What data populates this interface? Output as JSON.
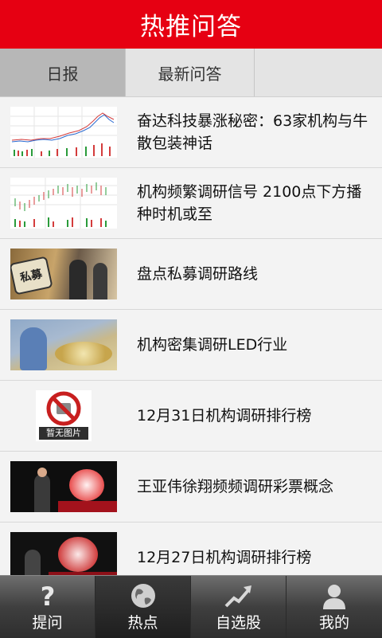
{
  "header": {
    "title": "热推问答"
  },
  "tabs": [
    {
      "label": "日报"
    },
    {
      "label": "最新问答"
    }
  ],
  "items": [
    {
      "title": "奋达科技暴涨秘密：63家机构与牛散包装神话",
      "thumb": "stock-chart-icon"
    },
    {
      "title": "机构频繁调研信号 2100点下方播种时机或至",
      "thumb": "stock-chart-icon"
    },
    {
      "title": "盘点私募调研路线",
      "thumb": "photo",
      "badge": "私募"
    },
    {
      "title": "机构密集调研LED行业",
      "thumb": "photo"
    },
    {
      "title": "12月31日机构调研排行榜",
      "thumb": "no-image-icon",
      "placeholder": "暂无图片"
    },
    {
      "title": "王亚伟徐翔频频调研彩票概念",
      "thumb": "photo"
    },
    {
      "title": "12月27日机构调研排行榜",
      "thumb": "photo"
    }
  ],
  "bottom_nav": [
    {
      "label": "提问",
      "icon": "question-icon"
    },
    {
      "label": "热点",
      "icon": "globe-icon",
      "active": true
    },
    {
      "label": "自选股",
      "icon": "trend-arrow-icon"
    },
    {
      "label": "我的",
      "icon": "user-icon"
    }
  ],
  "colors": {
    "accent": "#e60012"
  }
}
